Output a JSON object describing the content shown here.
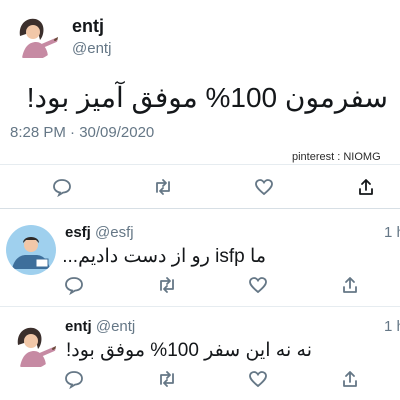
{
  "main_tweet": {
    "author_name": "entj",
    "author_handle": "@entj",
    "text": "سفرمون 100% موفق آمیز بود!",
    "timestamp": "8:28 PM · 30/09/2020"
  },
  "watermark": "pinterest : NIOMG",
  "replies": [
    {
      "author_name": "esfj",
      "author_handle": "@esfj",
      "time": "1 h",
      "text": "ما isfp رو از دست دادیم..."
    },
    {
      "author_name": "entj",
      "author_handle": "@entj",
      "time": "1 h",
      "text": "نه نه این سفر 100% موفق بود!"
    }
  ],
  "icons": {
    "reply": "reply-icon",
    "retweet": "retweet-icon",
    "like": "like-icon",
    "share": "share-icon"
  },
  "colors": {
    "muted": "#657786",
    "divider": "#e6ecf0"
  }
}
